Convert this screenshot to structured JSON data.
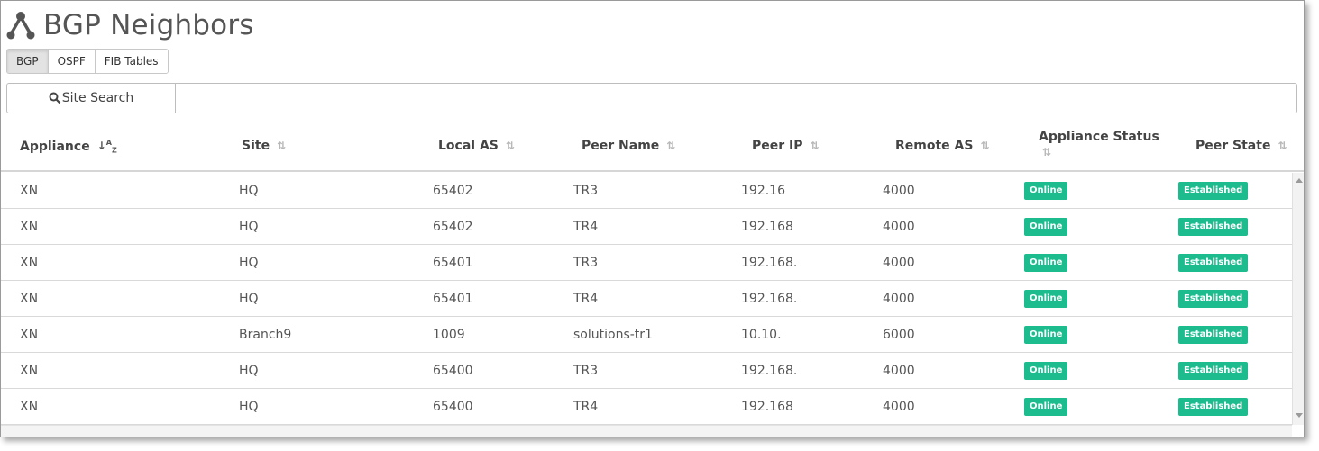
{
  "page": {
    "title": "BGP Neighbors",
    "icon": "network-topology-icon"
  },
  "tabs": [
    {
      "label": "BGP",
      "active": true
    },
    {
      "label": "OSPF",
      "active": false
    },
    {
      "label": "FIB Tables",
      "active": false
    }
  ],
  "search": {
    "button_label": "Site Search",
    "icon": "search-icon",
    "value": ""
  },
  "table": {
    "columns": [
      {
        "label": "Appliance",
        "sort": "ascending"
      },
      {
        "label": "Site",
        "sort": "none"
      },
      {
        "label": "Local AS",
        "sort": "none"
      },
      {
        "label": "Peer Name",
        "sort": "none"
      },
      {
        "label": "Peer IP",
        "sort": "none"
      },
      {
        "label": "Remote AS",
        "sort": "none"
      },
      {
        "label": "Appliance Status",
        "sort": "none"
      },
      {
        "label": "Peer State",
        "sort": "none"
      }
    ],
    "rows": [
      {
        "appliance": "XN",
        "site": "HQ",
        "local_as": "65402",
        "peer_name": "TR3",
        "peer_ip": "192.16",
        "remote_as": "4000",
        "status": "Online",
        "state": "Established"
      },
      {
        "appliance": "XN",
        "site": "HQ",
        "local_as": "65402",
        "peer_name": "TR4",
        "peer_ip": "192.168",
        "remote_as": "4000",
        "status": "Online",
        "state": "Established"
      },
      {
        "appliance": "XN",
        "site": "HQ",
        "local_as": "65401",
        "peer_name": "TR3",
        "peer_ip": "192.168.",
        "remote_as": "4000",
        "status": "Online",
        "state": "Established"
      },
      {
        "appliance": "XN",
        "site": "HQ",
        "local_as": "65401",
        "peer_name": "TR4",
        "peer_ip": "192.168.",
        "remote_as": "4000",
        "status": "Online",
        "state": "Established"
      },
      {
        "appliance": "XN",
        "site": "Branch9",
        "local_as": "1009",
        "peer_name": "solutions-tr1",
        "peer_ip": "10.10.",
        "remote_as": "6000",
        "status": "Online",
        "state": "Established"
      },
      {
        "appliance": "XN",
        "site": "HQ",
        "local_as": "65400",
        "peer_name": "TR3",
        "peer_ip": "192.168.",
        "remote_as": "4000",
        "status": "Online",
        "state": "Established"
      },
      {
        "appliance": "XN",
        "site": "HQ",
        "local_as": "65400",
        "peer_name": "TR4",
        "peer_ip": "192.168",
        "remote_as": "4000",
        "status": "Online",
        "state": "Established"
      }
    ]
  },
  "colors": {
    "badge": "#1cbc8f",
    "title": "#555555"
  }
}
